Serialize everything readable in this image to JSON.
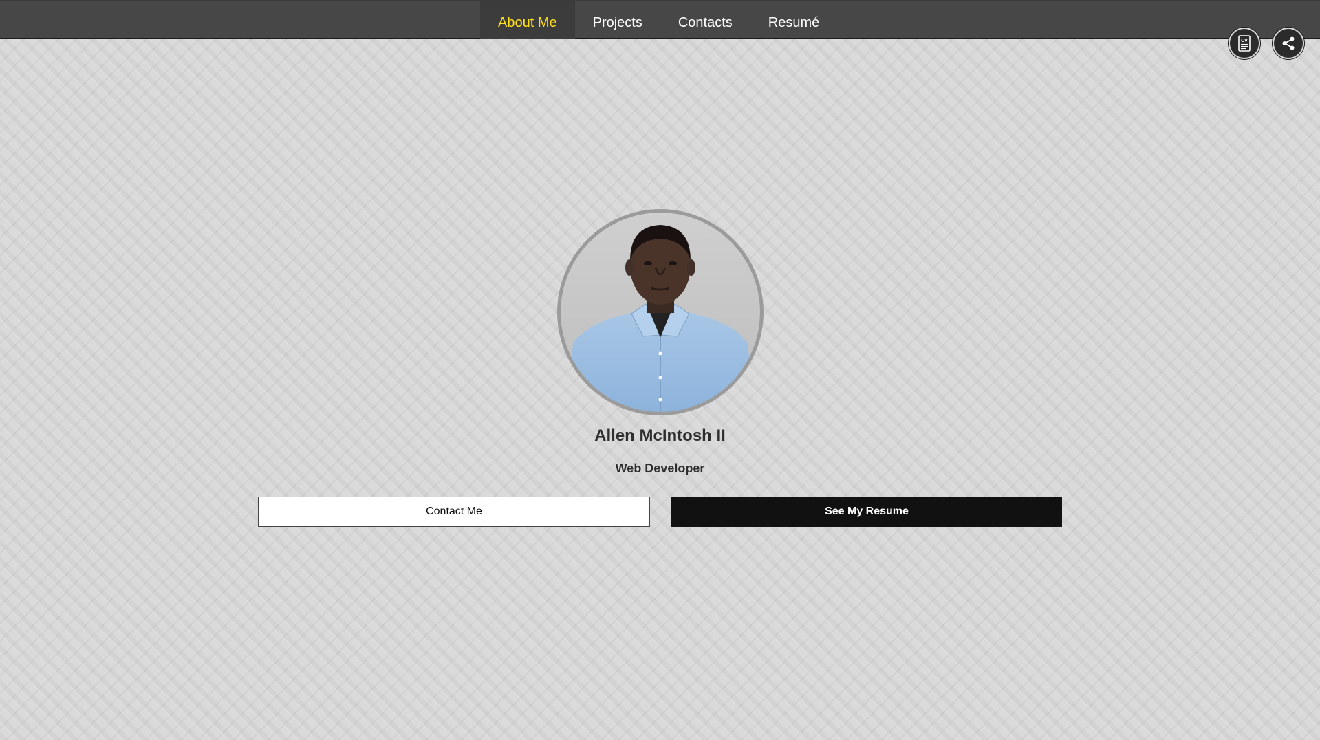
{
  "nav": {
    "items": [
      {
        "label": "About Me",
        "active": true
      },
      {
        "label": "Projects",
        "active": false
      },
      {
        "label": "Contacts",
        "active": false
      },
      {
        "label": "Resumé",
        "active": false
      }
    ]
  },
  "corner_actions": {
    "cv": {
      "icon": "cv-document-icon",
      "label": "CV"
    },
    "share": {
      "icon": "share-icon"
    }
  },
  "profile": {
    "name": "Allen McIntosh II",
    "role": "Web Developer"
  },
  "buttons": {
    "contact_label": "Contact Me",
    "resume_label": "See My Resume"
  },
  "colors": {
    "nav_bg": "#474747",
    "active_tab_bg": "#3c3c3c",
    "active_text": "#ffe01a",
    "page_bg": "#dadada",
    "resume_button_bg": "#111111"
  }
}
